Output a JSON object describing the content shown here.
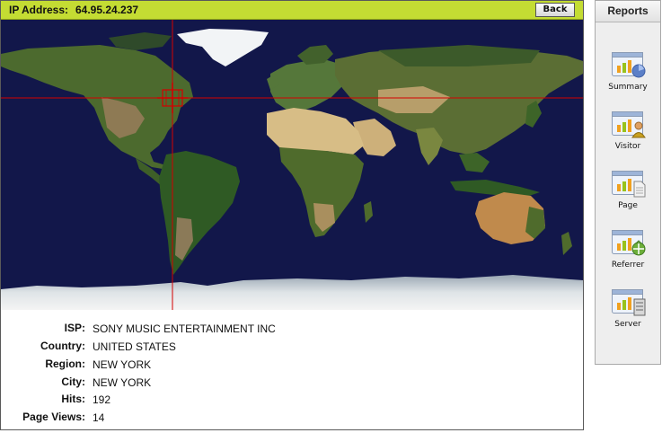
{
  "header": {
    "ip_label": "IP Address:",
    "ip_value": "64.95.24.237",
    "back_label": "Back"
  },
  "map": {
    "crosshair_color": "#d40000",
    "ocean_color": "#12174a",
    "land_color": "#4f6e32"
  },
  "details": [
    {
      "label": "ISP:",
      "value": "SONY MUSIC ENTERTAINMENT INC"
    },
    {
      "label": "Country:",
      "value": "UNITED STATES"
    },
    {
      "label": "Region:",
      "value": "NEW YORK"
    },
    {
      "label": "City:",
      "value": "NEW YORK"
    },
    {
      "label": "Hits:",
      "value": "192"
    },
    {
      "label": "Page Views:",
      "value": "14"
    }
  ],
  "reports": {
    "title": "Reports",
    "items": [
      {
        "label": "Summary",
        "icon": "summary-chart-icon"
      },
      {
        "label": "Visitor",
        "icon": "visitor-chart-icon"
      },
      {
        "label": "Page",
        "icon": "page-chart-icon"
      },
      {
        "label": "Referrer",
        "icon": "referrer-chart-icon"
      },
      {
        "label": "Server",
        "icon": "server-chart-icon"
      }
    ]
  }
}
